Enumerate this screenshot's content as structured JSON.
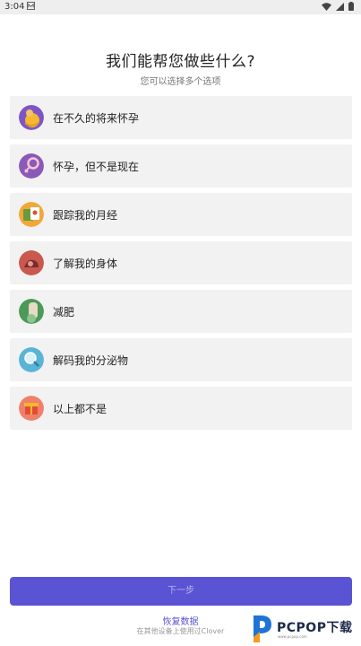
{
  "status_bar": {
    "time": "3:04"
  },
  "header": {
    "title": "我们能帮您做些什么?",
    "subtitle": "您可以选择多个选项"
  },
  "options": [
    {
      "label": "在不久的将来怀孕",
      "icon": "pregnant-belly-icon"
    },
    {
      "label": "怀孕，但不是现在",
      "icon": "female-symbol-icon"
    },
    {
      "label": "跟踪我的月经",
      "icon": "calendar-tracker-icon"
    },
    {
      "label": "了解我的身体",
      "icon": "body-icon"
    },
    {
      "label": "减肥",
      "icon": "weight-loss-icon"
    },
    {
      "label": "解码我的分泌物",
      "icon": "droplet-magnifier-icon"
    },
    {
      "label": "以上都不是",
      "icon": "gift-box-icon"
    }
  ],
  "footer": {
    "next_label": "下一步",
    "restore_label": "恢复数据",
    "restore_hint": "在其他设备上使用过Clover"
  },
  "watermark": {
    "brand": "PCPOP下载",
    "sub": "www.pcpop.com"
  },
  "colors": {
    "accent": "#5a53d4",
    "option_bg": "#f2f2f2"
  }
}
